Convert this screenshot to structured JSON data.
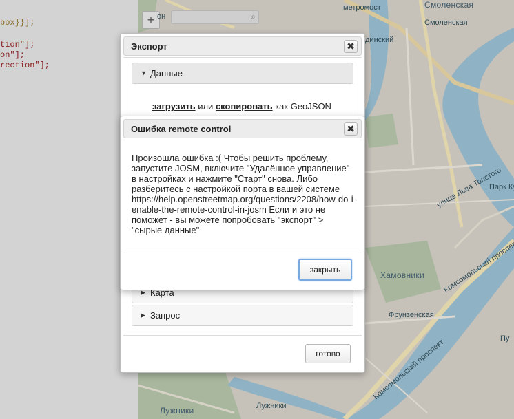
{
  "code_editor": {
    "lines": [
      {
        "plain": "",
        "str": "",
        "punct": "box}}];"
      },
      {
        "plain": "",
        "str": "tion\"];",
        "punct": ""
      },
      {
        "plain": "",
        "str": "on\"];",
        "punct": ""
      },
      {
        "plain": "",
        "str": "rection\"];",
        "punct": ""
      }
    ]
  },
  "map": {
    "zoom_in": "+",
    "labels": {
      "metro_top": "метромост",
      "smolenskaya": "Смоленская",
      "vinsky": "динский",
      "park": "Парк Ку",
      "tolstogo": "улица Льва Толстого",
      "khamovniki": "Хамовники",
      "komsomolsky": "Комсомольский проспект",
      "frunzenskaya": "Фрунзенская",
      "komsomolsky2": "Комсомольский проспект",
      "luzhniki": "Лужники",
      "luzhniki2": "Лужники",
      "pu": "Пу",
      "don": "он"
    }
  },
  "export_dialog": {
    "title": "Экспорт",
    "close_label": "✖",
    "sections": {
      "data": {
        "label": "Данные",
        "caret": "▼"
      },
      "map": {
        "label": "Карта",
        "caret": "▶"
      },
      "query": {
        "label": "Запрос",
        "caret": "▶"
      }
    },
    "download_link": "загрузить",
    "download_or": "или",
    "copy_link": "скопировать",
    "download_as": "как GeoJSON",
    "done_label": "готово"
  },
  "error_dialog": {
    "title": "Ошибка remote control",
    "close_label": "✖",
    "message": "Произошла ошибка :( Чтобы решить проблему, запустите JOSM, включите \"Удалённое управление\" в настройках и нажмите \"Старт\" снова. Либо разберитесь с настройкой порта в вашей системе https://help.openstreetmap.org/questions/2208/how-do-i-enable-the-remote-control-in-josm Если и это не поможет - вы можете попробовать \"экспорт\" > \"сырые данные\"",
    "close_button_label": "закрыть"
  },
  "colors": {
    "dialog_header_bg": "#ececec",
    "focus_ring": "#7aa9e0",
    "map_bg": "#c9c6bf",
    "code_bg": "#d3d3d3"
  }
}
